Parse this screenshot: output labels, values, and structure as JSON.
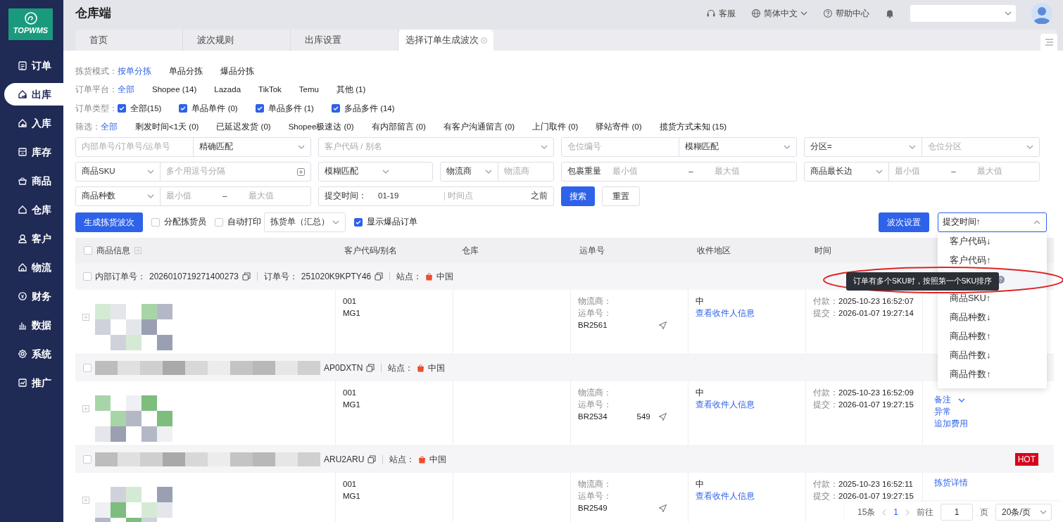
{
  "app": {
    "logo": "TOPWMS",
    "title": "仓库端"
  },
  "sidebar": {
    "items": [
      {
        "label": "订单",
        "selected": false
      },
      {
        "label": "出库",
        "selected": true
      },
      {
        "label": "入库",
        "selected": false
      },
      {
        "label": "库存",
        "selected": false
      },
      {
        "label": "商品",
        "selected": false
      },
      {
        "label": "仓库",
        "selected": false
      },
      {
        "label": "客户",
        "selected": false
      },
      {
        "label": "物流",
        "selected": false
      },
      {
        "label": "财务",
        "selected": false
      },
      {
        "label": "数据",
        "selected": false
      },
      {
        "label": "系统",
        "selected": false
      },
      {
        "label": "推广",
        "selected": false
      }
    ]
  },
  "header": {
    "links": [
      {
        "label": "客服",
        "dropdown": false
      },
      {
        "label": "简体中文",
        "dropdown": true
      },
      {
        "label": "帮助中心",
        "dropdown": false
      }
    ]
  },
  "tabs": [
    {
      "label": "首页",
      "selected": false,
      "closable": false
    },
    {
      "label": "波次规则",
      "selected": false,
      "closable": false
    },
    {
      "label": "出库设置",
      "selected": false,
      "closable": false
    },
    {
      "label": "选择订单生成波次",
      "selected": true,
      "closable": true
    }
  ],
  "filter_groups": [
    {
      "label": "拣货模式：",
      "kind": "link",
      "options": [
        {
          "label": "按单分拣",
          "selected": true
        },
        {
          "label": "单品分拣",
          "selected": false
        },
        {
          "label": "爆品分拣",
          "selected": false
        }
      ]
    },
    {
      "label": "订单平台：",
      "kind": "link",
      "options": [
        {
          "label": "全部",
          "selected": true
        },
        {
          "label": "Shopee (14)",
          "selected": false
        },
        {
          "label": "Lazada",
          "selected": false
        },
        {
          "label": "TikTok",
          "selected": false
        },
        {
          "label": "Temu",
          "selected": false
        },
        {
          "label": "其他 (1)",
          "selected": false
        }
      ]
    },
    {
      "label": "订单类型：",
      "kind": "check",
      "options": [
        {
          "label": "全部(15)",
          "checked": true
        },
        {
          "label": "单品单件 (0)",
          "checked": true
        },
        {
          "label": "单品多件 (1)",
          "checked": true
        },
        {
          "label": "多品多件 (14)",
          "checked": true
        }
      ]
    },
    {
      "label": "筛选：",
      "kind": "link",
      "options": [
        {
          "label": "全部",
          "selected": true
        },
        {
          "label": "剩发时间<1天 (0)",
          "selected": false
        },
        {
          "label": "已延迟发货 (0)",
          "selected": false
        },
        {
          "label": "Shopee极速达 (0)",
          "selected": false
        },
        {
          "label": "有内部留言 (0)",
          "selected": false
        },
        {
          "label": "有客户沟通留言 (0)",
          "selected": false
        },
        {
          "label": "上门取件 (0)",
          "selected": false
        },
        {
          "label": "驿站寄件 (0)",
          "selected": false
        },
        {
          "label": "揽货方式未知 (15)",
          "selected": false
        }
      ]
    }
  ],
  "search_rows": [
    [
      [
        {
          "kind": "input",
          "placeholder": "内部单号/订单号/运单号"
        },
        {
          "kind": "select",
          "value": "精确匹配"
        }
      ],
      [
        {
          "kind": "select",
          "placeholder": "客户代码 / 别名"
        }
      ],
      [
        {
          "kind": "input",
          "placeholder": "仓位编号"
        },
        {
          "kind": "select",
          "value": "模糊匹配"
        }
      ],
      [
        {
          "kind": "select",
          "value": "分区="
        },
        {
          "kind": "select",
          "placeholder": "仓位分区"
        }
      ]
    ],
    [
      [
        {
          "kind": "select",
          "value": "商品SKU"
        },
        {
          "kind": "input",
          "placeholder": "多个用逗号分隔",
          "icon": true
        }
      ],
      [
        {
          "kind": "select",
          "value": "模糊匹配"
        },
        {
          "kind": "gap"
        },
        {
          "kind": "select",
          "value": "物流商"
        },
        {
          "kind": "input",
          "placeholder": "物流商"
        }
      ],
      [
        {
          "kind": "label",
          "value": "包裹重量"
        },
        {
          "kind": "range",
          "min": "最小值",
          "dash": "–",
          "max": "最大值"
        }
      ],
      [
        {
          "kind": "select",
          "value": "商品最长边"
        },
        {
          "kind": "range",
          "min": "最小值",
          "dash": "–",
          "max": "最大值"
        }
      ]
    ],
    [
      [
        {
          "kind": "select",
          "value": "商品种数"
        },
        {
          "kind": "range",
          "min": "最小值",
          "dash": "–",
          "max": "最大值"
        }
      ],
      [
        {
          "kind": "label",
          "value": "提交时间："
        },
        {
          "kind": "date",
          "value": "01-19",
          "placeholder": "时间点",
          "suffix": "之前"
        }
      ],
      [
        {
          "kind": "primary",
          "value": "搜索"
        },
        {
          "kind": "gap"
        },
        {
          "kind": "plain",
          "value": "重置"
        }
      ]
    ]
  ],
  "toolbar": {
    "generate": "生成拣货波次",
    "options": [
      {
        "label": "分配拣货员",
        "checked": false
      },
      {
        "label": "自动打印",
        "checked": false
      }
    ],
    "print_select": "拣货单（汇总）",
    "hot_toggle": {
      "label": "显示爆品订单",
      "checked": true
    },
    "wave_settings": "波次设置",
    "sort": {
      "value": "提交时间↑",
      "expanded": true
    }
  },
  "table": {
    "select_all": {
      "checked": false
    },
    "columns": [
      "商品信息",
      "客户代码/别名",
      "仓库",
      "运单号",
      "收件地区",
      "时间"
    ],
    "orders": [
      {
        "checked": false,
        "header": [
          {
            "label": "内部订单号：",
            "value": "2026010719271400273"
          },
          {
            "label": "订单号：",
            "value": "251020K9KPTY46"
          }
        ],
        "site_label": "站点：",
        "site": "中国",
        "hot": false,
        "customer": [
          "001",
          "MG1"
        ],
        "carrier_label": "物流商：",
        "waybill_label": "运单号：",
        "waybill": [
          "BR2561"
        ],
        "region": "中",
        "recipient_link": "查看收件人信息",
        "times": [
          {
            "label": "付款：",
            "value": "2025-10-23 16:52:07"
          },
          {
            "label": "提交：",
            "value": "2026-01-07 19:27:14"
          }
        ]
      },
      {
        "checked": false,
        "header": [
          {
            "value": "AP0DXTN"
          }
        ],
        "site_label": "站点：",
        "site": "中国",
        "hot": false,
        "customer": [
          "001",
          "MG1"
        ],
        "carrier_label": "物流商：",
        "waybill_label": "运单号：",
        "waybill": [
          "BR2534",
          "549"
        ],
        "region": "中",
        "recipient_link": "查看收件人信息",
        "times": [
          {
            "label": "付款：",
            "value": "2025-10-23 16:52:09"
          },
          {
            "label": "提交：",
            "value": "2026-01-07 19:27:15"
          }
        ],
        "actions": [
          {
            "label": "备注",
            "dropdown": true
          },
          {
            "label": "异常",
            "dropdown": false
          },
          {
            "label": "追加费用",
            "dropdown": false
          }
        ]
      },
      {
        "checked": false,
        "header": [
          {
            "value": "ARU2ARU"
          }
        ],
        "site_label": "站点：",
        "site": "中国",
        "hot": true,
        "hot_label": "HOT",
        "customer": [
          "001",
          "MG1"
        ],
        "carrier_label": "物流商：",
        "waybill_label": "运单号：",
        "waybill": [
          "BR2549"
        ],
        "region": "中",
        "recipient_link": "查看收件人信息",
        "times": [
          {
            "label": "付款：",
            "value": "2025-10-23 16:52:11"
          },
          {
            "label": "提交：",
            "value": "2026-01-07 19:27:15"
          }
        ],
        "actions": [
          {
            "label": "拣货详情",
            "dropdown": false
          }
        ]
      }
    ]
  },
  "sort_menu": {
    "items": [
      {
        "label": "客户代码↓",
        "hovered": false
      },
      {
        "label": "客户代码↑",
        "hovered": false
      },
      {
        "hint": true,
        "hovered": true
      },
      {
        "label": "商品SKU↑",
        "hovered": false
      },
      {
        "label": "商品种数↓",
        "hovered": false
      },
      {
        "label": "商品种数↑",
        "hovered": false
      },
      {
        "label": "商品件数↓",
        "hovered": false
      },
      {
        "label": "商品件数↑",
        "hovered": false
      }
    ],
    "tooltip": "订单有多个SKU时，按照第一个SKU排序"
  },
  "annotation": {
    "kind": "ellipse"
  },
  "pagination": {
    "total": "15条",
    "pages": [
      {
        "label": "1",
        "selected": true
      }
    ],
    "goto_label": "前往",
    "goto_value": "1",
    "page_unit": "页",
    "page_size": "20条/页"
  }
}
